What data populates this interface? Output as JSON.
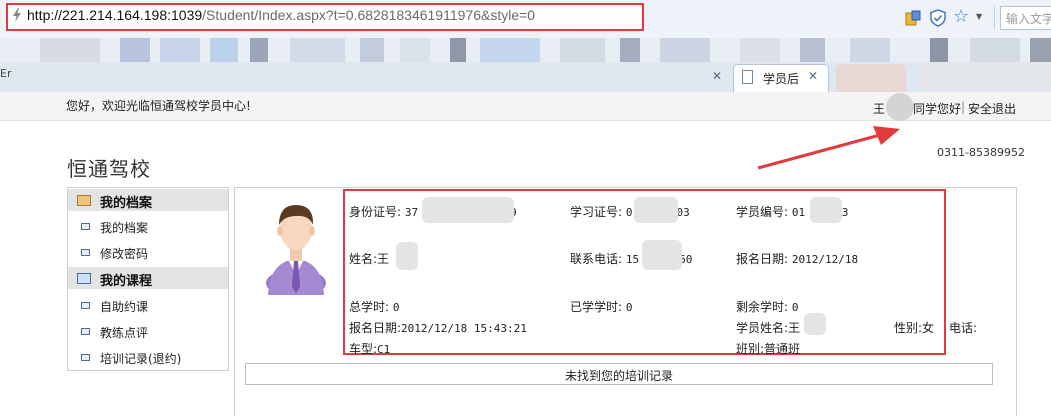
{
  "browser": {
    "url_host": "http://221.214.164.198:1039",
    "url_rest": "/Student/Index.aspx?t=0.6828183461911976&style=0",
    "search_placeholder": "输入文字",
    "tabs": [
      {
        "label": "Er",
        "active": false
      },
      {
        "label": "学员后",
        "active": true
      }
    ]
  },
  "header": {
    "welcome": "您好，欢迎光临恒通驾校学员中心!",
    "user_prefix": "王",
    "user_suffix": "同学您好",
    "separator": "|",
    "logout": "安全退出"
  },
  "site": {
    "title": "恒通驾校",
    "phone": "0311-85389952"
  },
  "sidebar": {
    "sections": [
      {
        "title": "我的档案",
        "items": [
          "我的档案",
          "修改密码"
        ]
      },
      {
        "title": "我的课程",
        "items": [
          "自助约课",
          "教练点评",
          "培训记录(退约)"
        ]
      }
    ]
  },
  "student_info": {
    "id_label": "身份证号:",
    "id_start": "37",
    "id_end": "9",
    "study_no_label": "学习证号:",
    "study_no_start": "0",
    "study_no_end": "03",
    "student_no_label": "学员编号:",
    "student_no_start": "01",
    "student_no_end": "03",
    "name_label": "姓名:",
    "name_start": "王",
    "phone_label": "联系电话:",
    "phone_start": "15",
    "phone_end": "60",
    "enroll_label": "报名日期:",
    "enroll_value": "2012/12/18",
    "total_hours_label": "总学时:",
    "total_hours": "0",
    "done_hours_label": "已学学时:",
    "done_hours": "0",
    "left_hours_label": "剩余学时:",
    "left_hours": "0",
    "enroll_dt_label": "报名日期:",
    "enroll_dt_value": "2012/12/18 15:43:21",
    "student_name_label": "学员姓名:",
    "student_name_start": "王",
    "gender_label": "性别:",
    "gender_value": "女",
    "tel_label": "电话:",
    "car_label": "车型:",
    "car_value": "C1",
    "class_label": "班别:",
    "class_value": "普通班"
  },
  "records": {
    "empty_message": "未找到您的培训记录"
  },
  "colors": {
    "highlight": "#e13a3a",
    "url_host": "#111111",
    "url_rest": "#6a6a6a"
  }
}
